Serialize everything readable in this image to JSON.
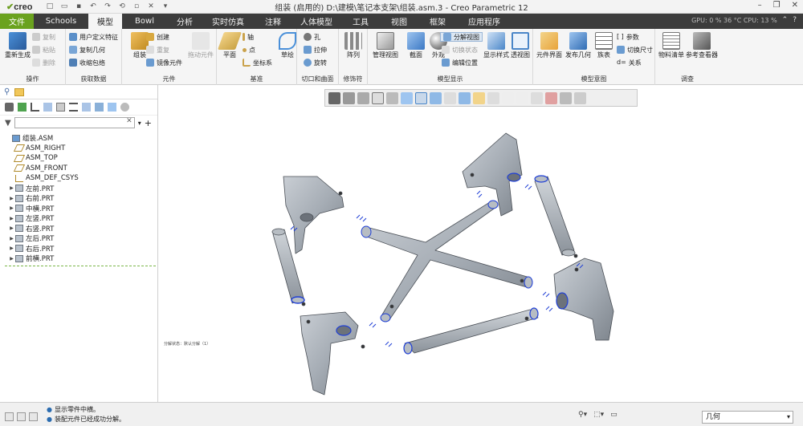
{
  "titlebar": {
    "logo": "creo",
    "title": "组装 (启用的) D:\\建模\\笔记本支架\\组装.asm.3 - Creo Parametric 12"
  },
  "tabs": [
    {
      "label": "文件"
    },
    {
      "label": "Schools"
    },
    {
      "label": "模型"
    },
    {
      "label": "Bowl"
    },
    {
      "label": "分析"
    },
    {
      "label": "实时仿真"
    },
    {
      "label": "注释"
    },
    {
      "label": "人体模型"
    },
    {
      "label": "工具"
    },
    {
      "label": "视图"
    },
    {
      "label": "框架"
    },
    {
      "label": "应用程序"
    }
  ],
  "tabbar_right": {
    "gpu": "GPU: 0 %  36 °C  CPU: 13 %"
  },
  "ribbon": {
    "operations": {
      "label": "操作",
      "regenerate": "重新生成",
      "copy": "复制",
      "paste": "粘贴",
      "delete": "删除"
    },
    "get_data": {
      "label": "获取数据",
      "udf": "用户定义特征",
      "copy_geom": "复制几何",
      "shrinkwrap": "收缩包络"
    },
    "components": {
      "label": "元件",
      "assemble": "组装",
      "create": "创建",
      "repeat": "重复",
      "mirror": "镜像元件",
      "drag": "拖动元件"
    },
    "datum": {
      "label": "基准",
      "plane": "平面",
      "axis": "轴",
      "point": "点",
      "csys": "坐标系",
      "sketch": "草绘"
    },
    "cut_surface": {
      "label": "切口和曲面",
      "hole": "孔",
      "extrude": "拉伸",
      "revolve": "旋转"
    },
    "modifiers": {
      "label": "修饰符",
      "pattern": "阵列"
    },
    "model_display": {
      "label": "模型显示",
      "manage_views": "管理视图",
      "section": "截面",
      "appearance": "外观",
      "explode": "分解视图",
      "toggle_status": "切换状态",
      "edit_position": "编辑位置",
      "display_style": "显示样式",
      "perspective": "透视图"
    },
    "model_intent": {
      "label": "模型意图",
      "component_interface": "元件界面",
      "publish_geom": "发布几何",
      "family_table": "族表",
      "parameters": "参数",
      "switch_dims": "切换尺寸",
      "relations": "关系"
    },
    "investigate": {
      "label": "调查",
      "bom": "物料清单",
      "reference_viewer": "参考查看器"
    }
  },
  "model_tree": {
    "filter_placeholder": "",
    "items": [
      {
        "label": "组装.ASM",
        "type": "asm",
        "expandable": false
      },
      {
        "label": "ASM_RIGHT",
        "type": "plane",
        "expandable": false
      },
      {
        "label": "ASM_TOP",
        "type": "plane",
        "expandable": false
      },
      {
        "label": "ASM_FRONT",
        "type": "plane",
        "expandable": false
      },
      {
        "label": "ASM_DEF_CSYS",
        "type": "csys",
        "expandable": false
      },
      {
        "label": "左前.PRT",
        "type": "part",
        "expandable": true
      },
      {
        "label": "右前.PRT",
        "type": "part",
        "expandable": true
      },
      {
        "label": "中横.PRT",
        "type": "part",
        "expandable": true
      },
      {
        "label": "左竖.PRT",
        "type": "part",
        "expandable": true
      },
      {
        "label": "右竖.PRT",
        "type": "part",
        "expandable": true
      },
      {
        "label": "左后.PRT",
        "type": "part",
        "expandable": true
      },
      {
        "label": "右后.PRT",
        "type": "part",
        "expandable": true
      },
      {
        "label": "前横.PRT",
        "type": "part",
        "expandable": true
      }
    ]
  },
  "graphics": {
    "small_note": "分解状态：默认分解（1）"
  },
  "status": {
    "messages": [
      "显示零件中横。",
      "装配元件已经成功分解。"
    ],
    "filter_value": "几何"
  },
  "colors": {
    "accent_green": "#6aa21e",
    "tab_dark": "#3c3c3c",
    "part_fill": "#a9b0b8",
    "constraint_blue": "#1f3fd6"
  }
}
